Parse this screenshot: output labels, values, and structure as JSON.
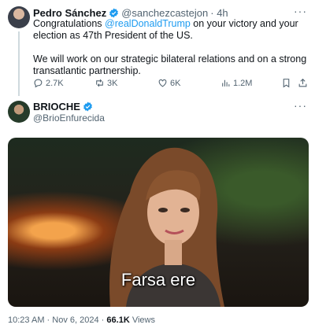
{
  "tweet1": {
    "name": "Pedro Sánchez",
    "handle": "@sanchezcastejon",
    "time": "· 4h",
    "text_prefix": "Congratulations ",
    "mention": "@realDonaldTrump",
    "text_suffix": " on your victory and your election as 47th President of the US.",
    "paragraph2": "We will work on our strategic bilateral relations and on a strong transatlantic partnership.",
    "replies": "2.7K",
    "reposts": "3K",
    "likes": "6K",
    "views": "1.2M",
    "more": "···"
  },
  "tweet2": {
    "name": "BRIOCHE",
    "handle": "@BrioEnfurecida",
    "more": "···",
    "media_caption": "Farsa ere",
    "time": "10:23 AM",
    "date": "Nov 6, 2024",
    "views_count": "66.1K",
    "views_label": "Views"
  },
  "colors": {
    "accent": "#1d9bf0",
    "text": "#0f1419",
    "secondary": "#536471"
  },
  "icons": [
    "verified-badge-icon",
    "reply-icon",
    "repost-icon",
    "like-icon",
    "views-icon",
    "bookmark-icon",
    "share-icon",
    "more-icon"
  ]
}
